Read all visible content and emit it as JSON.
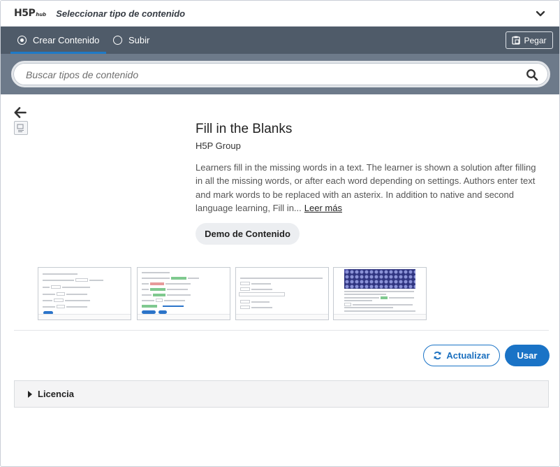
{
  "header": {
    "logo_main": "H5P",
    "logo_sub": "hub",
    "title": "Seleccionar tipo de contenido",
    "chevron_icon": "chevron-down-icon"
  },
  "tabs": [
    {
      "label": "Crear Contenido",
      "selected": true
    },
    {
      "label": "Subir",
      "selected": false
    }
  ],
  "paste": {
    "label": "Pegar",
    "icon": "clipboard-icon"
  },
  "search": {
    "placeholder": "Buscar tipos de contenido",
    "value": "",
    "icon": "search-icon"
  },
  "detail": {
    "back_icon": "arrow-left-icon",
    "title": "Fill in the Blanks",
    "owner": "H5P Group",
    "description": "Learners fill in the missing words in a text. The learner is shown a solution after filling in all the missing words, or after each word depending on settings. Authors enter text and mark words to be replaced with an asterix. In addition to native and second language learning, Fill in...",
    "read_more": "Leer más",
    "demo_label": "Demo de Contenido"
  },
  "actions": {
    "update_label": "Actualizar",
    "update_icon": "refresh-icon",
    "use_label": "Usar"
  },
  "license": {
    "label": "Licencia"
  },
  "colors": {
    "tabbar": "#4f5b69",
    "searchbar": "#6d7a8a",
    "accent": "#1a73c6"
  }
}
